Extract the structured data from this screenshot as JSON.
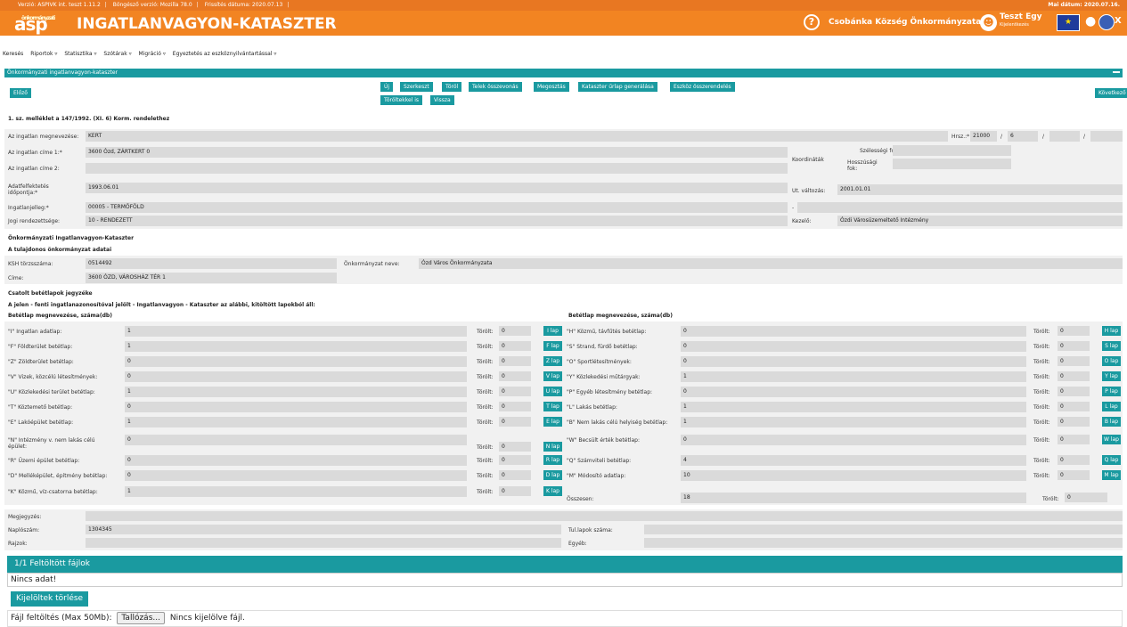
{
  "topbar": {
    "version": "Verzió: ASPIVK int. teszt 1.11.2",
    "browser": "Böngésző verzió: Mozilla 78.0",
    "updated": "Frissítés dátuma: 2020.07.13",
    "today": "Mai dátum: 2020.07.16."
  },
  "header": {
    "logo_small": "önkormányzati",
    "logo": "asp",
    "title": "INGATLANVAGYON-KATASZTER",
    "help": "?",
    "org": "Csobánka Község Önkormányzata",
    "user": "Teszt Egy",
    "logout": "Kijelentkezés",
    "close": "X"
  },
  "menu": [
    "Keresés",
    "Riportok ▿",
    "Statisztika ▿",
    "Szótárak ▿",
    "Migráció ▿",
    "Egyeztetés az eszköznyilvántartással ▿"
  ],
  "panel_title": "Önkormányzati ingatlanvagyon-kataszter",
  "nav": {
    "prev": "Előző",
    "next": "Következő"
  },
  "actions": [
    "Új",
    "Szerkeszt",
    "Töröl",
    "Telek összevonás",
    "Megosztás",
    "Kataszter űrlap generálása",
    "Eszköz összerendelés"
  ],
  "actions2": [
    "Töröltekkel is",
    "Vissza"
  ],
  "section1": "1. sz. melléklet a 147/1992. (XI. 6) Korm. rendelethez",
  "form": {
    "name_label": "Az ingatlan megnevezése:",
    "name": "KERT",
    "hrsz_label": "Hrsz.:*",
    "hrsz1": "21000",
    "slash": "/",
    "hrsz2": "6",
    "addr1_label": "Az ingatlan címe 1:*",
    "addr1": "3600 Ózd, ZÁRTKERT 0",
    "addr2_label": "Az ingatlan címe 2:",
    "coord_label": "Koordináták",
    "lat_label": "Szélességi fok:",
    "lon_label": "Hosszúsági fok:",
    "date_label": "Adatfelfektetés időpontja:*",
    "date": "1993.06.01",
    "ut_label": "Ut. változás:",
    "ut": "2001.01.01",
    "jelleg_label": "Ingatlanjelleg:*",
    "jelleg": "00005 - TERMŐFÖLD",
    "dash": "-",
    "jogi_label": "Jogi rendezettsége:",
    "jogi": "10 - RENDEZETT",
    "kezelo_label": "Kezelő:",
    "kezelo": "Ózdi Városüzemeltető Intézmény"
  },
  "owner": {
    "title": "Önkormányzati Ingatlanvagyon-Kataszter",
    "subtitle": "A tulajdonos önkormányzat adatai",
    "ksh_label": "KSH törzsszáma:",
    "ksh": "0514492",
    "name_label": "Önkormányzat neve:",
    "name": "Ózd Város Önkormányzata",
    "addr_label": "Címe:",
    "addr": "3600 ÓZD, VÁROSHÁZ TÉR 1"
  },
  "lapok": {
    "title": "Csatolt betétlapok jegyzéke",
    "subtitle": "A jelen - fenti ingatlanazonosítóval jelölt - Ingatlanvagyon - Kataszter az alábbi, kitöltött lapokból áll:",
    "col_header": "Betétlap megnevezése, száma(db)",
    "deleted_label": "Törölt:",
    "left": [
      {
        "label": "\"I\" Ingatlan adatlap:",
        "count": "1",
        "deleted": "0",
        "btn": "I lap"
      },
      {
        "label": "\"F\" Földterület betétlap:",
        "count": "1",
        "deleted": "0",
        "btn": "F lap"
      },
      {
        "label": "\"Z\" Zöldterület betétlap:",
        "count": "0",
        "deleted": "0",
        "btn": "Z lap"
      },
      {
        "label": "\"V\" Vizek, közcélú létesítmények:",
        "count": "0",
        "deleted": "0",
        "btn": "V lap"
      },
      {
        "label": "\"U\" Közlekedési terület betétlap:",
        "count": "1",
        "deleted": "0",
        "btn": "U lap"
      },
      {
        "label": "\"T\" Köztemető betétlap:",
        "count": "0",
        "deleted": "0",
        "btn": "T lap"
      },
      {
        "label": "\"E\" Lakóépület betétlap:",
        "count": "1",
        "deleted": "0",
        "btn": "E lap"
      },
      {
        "label": "\"N\" Intézmény v. nem lakás célú épület:",
        "count": "0",
        "deleted": "0",
        "btn": "N lap"
      },
      {
        "label": "\"R\" Üzemi épület betétlap:",
        "count": "0",
        "deleted": "0",
        "btn": "R lap"
      },
      {
        "label": "\"D\" Melléképület, építmény betétlap:",
        "count": "0",
        "deleted": "0",
        "btn": "D lap"
      },
      {
        "label": "\"K\" Közmű, víz-csatorna betétlap:",
        "count": "1",
        "deleted": "0",
        "btn": "K lap"
      }
    ],
    "right": [
      {
        "label": "\"H\" Közmű, távfűtés betétlap:",
        "count": "0",
        "deleted": "0",
        "btn": "H lap"
      },
      {
        "label": "\"S\" Strand, fürdő betétlap:",
        "count": "0",
        "deleted": "0",
        "btn": "S lap"
      },
      {
        "label": "\"O\" Sportlétesítmények:",
        "count": "0",
        "deleted": "0",
        "btn": "O lap"
      },
      {
        "label": "\"Y\" Közlekedési műtárgyak:",
        "count": "1",
        "deleted": "0",
        "btn": "Y lap"
      },
      {
        "label": "\"P\" Egyéb létesítmény betétlap:",
        "count": "0",
        "deleted": "0",
        "btn": "P lap"
      },
      {
        "label": "\"L\" Lakás betétlap:",
        "count": "1",
        "deleted": "0",
        "btn": "L lap"
      },
      {
        "label": "\"B\" Nem lakás célú helyiség betétlap:",
        "count": "1",
        "deleted": "0",
        "btn": "B lap"
      },
      {
        "label": "\"W\" Becsült érték betétlap:",
        "count": "0",
        "deleted": "0",
        "btn": "W lap"
      },
      {
        "label": "\"Q\" Számviteli betétlap:",
        "count": "4",
        "deleted": "0",
        "btn": "Q lap"
      },
      {
        "label": "\"M\" Módosító adatlap:",
        "count": "10",
        "deleted": "0",
        "btn": "M lap"
      }
    ],
    "total_label": "Összesen:",
    "total": "18",
    "total_deleted": "0"
  },
  "bottom": {
    "note_label": "Megjegyzés:",
    "naplo_label": "Naplószám:",
    "naplo": "1304345",
    "rajzok_label": "Rajzok:",
    "tul_label": "Tul.lapok száma:",
    "egyeb_label": "Egyéb:"
  },
  "files": {
    "title": "1/1  Feltöltött fájlok",
    "empty": "Nincs adat!",
    "delete": "Kijelöltek törlése",
    "upload_label": "Fájl feltöltés (Max 50Mb):",
    "browse": "Tallózás...",
    "no_file": "Nincs kijelölve fájl."
  }
}
